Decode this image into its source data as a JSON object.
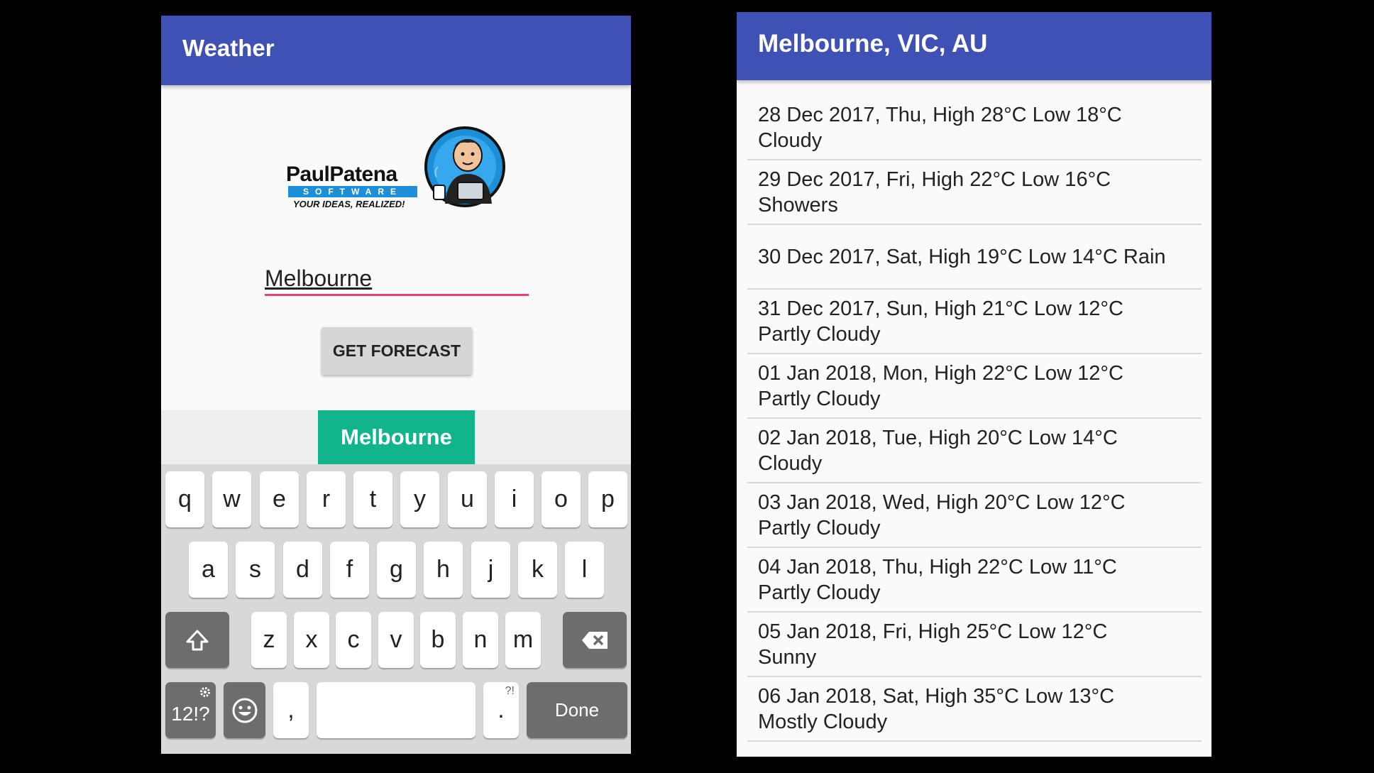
{
  "left": {
    "title": "Weather",
    "logo": {
      "name": "PaulPatena",
      "sub": "SOFTWARE",
      "tagline": "YOUR IDEAS, REALIZED!"
    },
    "city_input": {
      "value": "Melbourne"
    },
    "forecast_button": "GET FORECAST",
    "keyboard": {
      "suggestion": "Melbourne",
      "row1": [
        "q",
        "w",
        "e",
        "r",
        "t",
        "y",
        "u",
        "i",
        "o",
        "p"
      ],
      "row2": [
        "a",
        "s",
        "d",
        "f",
        "g",
        "h",
        "j",
        "k",
        "l"
      ],
      "row3": [
        "z",
        "x",
        "c",
        "v",
        "b",
        "n",
        "m"
      ],
      "symbols_label": "12!?",
      "comma": ",",
      "period": ".",
      "period_hint": "?!",
      "done_label": "Done",
      "icons": {
        "shift": "shift-icon",
        "backspace": "backspace-icon",
        "emoji": "emoji-icon",
        "settings": "gear-icon"
      }
    }
  },
  "right": {
    "title": "Melbourne, VIC, AU",
    "forecast": [
      {
        "line1": "28 Dec 2017, Thu, High 28°C  Low 18°C",
        "line2": "Cloudy"
      },
      {
        "line1": "29 Dec 2017, Fri, High 22°C  Low 16°C",
        "line2": "Showers"
      },
      {
        "line1": "30 Dec 2017, Sat, High 19°C  Low 14°C Rain",
        "line2": ""
      },
      {
        "line1": "31 Dec 2017, Sun, High 21°C  Low 12°C",
        "line2": "Partly Cloudy"
      },
      {
        "line1": "01 Jan 2018, Mon, High 22°C  Low 12°C",
        "line2": "Partly Cloudy"
      },
      {
        "line1": "02 Jan 2018, Tue, High 20°C  Low 14°C",
        "line2": "Cloudy"
      },
      {
        "line1": "03 Jan 2018, Wed, High 20°C  Low 12°C",
        "line2": "Partly Cloudy"
      },
      {
        "line1": "04 Jan 2018, Thu, High 22°C  Low 11°C",
        "line2": "Partly Cloudy"
      },
      {
        "line1": "05 Jan 2018, Fri, High 25°C  Low 12°C",
        "line2": "Sunny"
      },
      {
        "line1": "06 Jan 2018, Sat, High 35°C  Low 13°C",
        "line2": "Mostly Cloudy"
      }
    ]
  },
  "colors": {
    "appbar": "#3f51b5",
    "accent": "#e8417c",
    "suggestion": "#12b48c"
  }
}
